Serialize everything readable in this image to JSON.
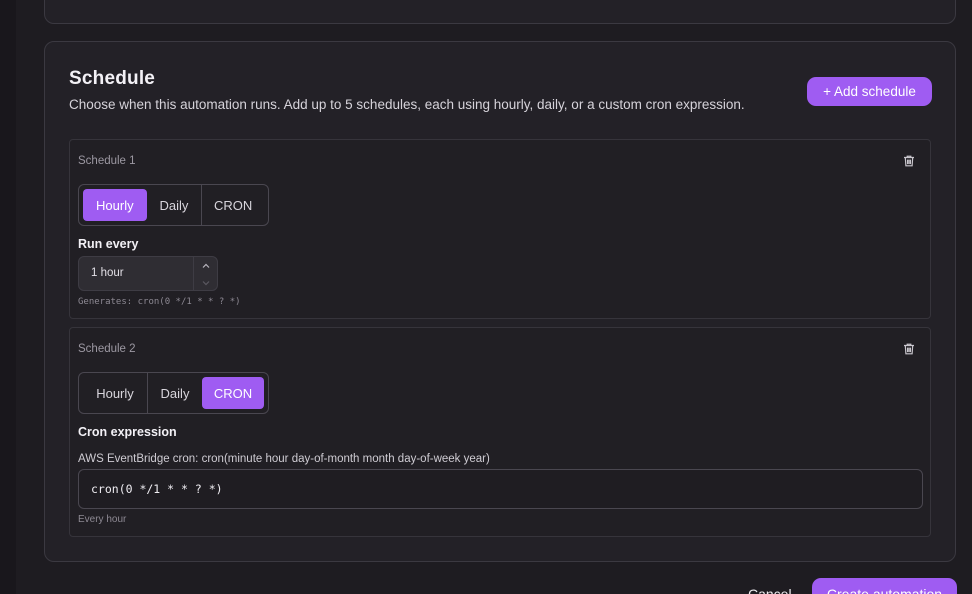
{
  "schedule_section": {
    "title": "Schedule",
    "description": "Choose when this automation runs. Add up to 5 schedules, each using hourly, daily, or a custom cron expression.",
    "add_button": "+ Add schedule"
  },
  "schedules": [
    {
      "label": "Schedule 1",
      "modes": [
        "Hourly",
        "Daily",
        "CRON"
      ],
      "selected_mode": "Hourly",
      "field_label": "Run every",
      "interval_value": "1 hour",
      "generated": "Generates: cron(0 */1 * * ? *)"
    },
    {
      "label": "Schedule 2",
      "modes": [
        "Hourly",
        "Daily",
        "CRON"
      ],
      "selected_mode": "CRON",
      "field_label": "Cron expression",
      "help": "AWS EventBridge cron: cron(minute hour day-of-month month day-of-week year)",
      "cron_value": "cron(0 */1 * * ? *)",
      "description": "Every hour"
    }
  ],
  "footer": {
    "cancel": "Cancel",
    "create": "Create automation"
  },
  "colors": {
    "accent": "#9f5cf2",
    "background": "#1e1c21",
    "card": "#232127"
  },
  "icons": {
    "delete": "trash-icon",
    "increment": "chevron-up-icon",
    "decrement": "chevron-down-icon"
  }
}
